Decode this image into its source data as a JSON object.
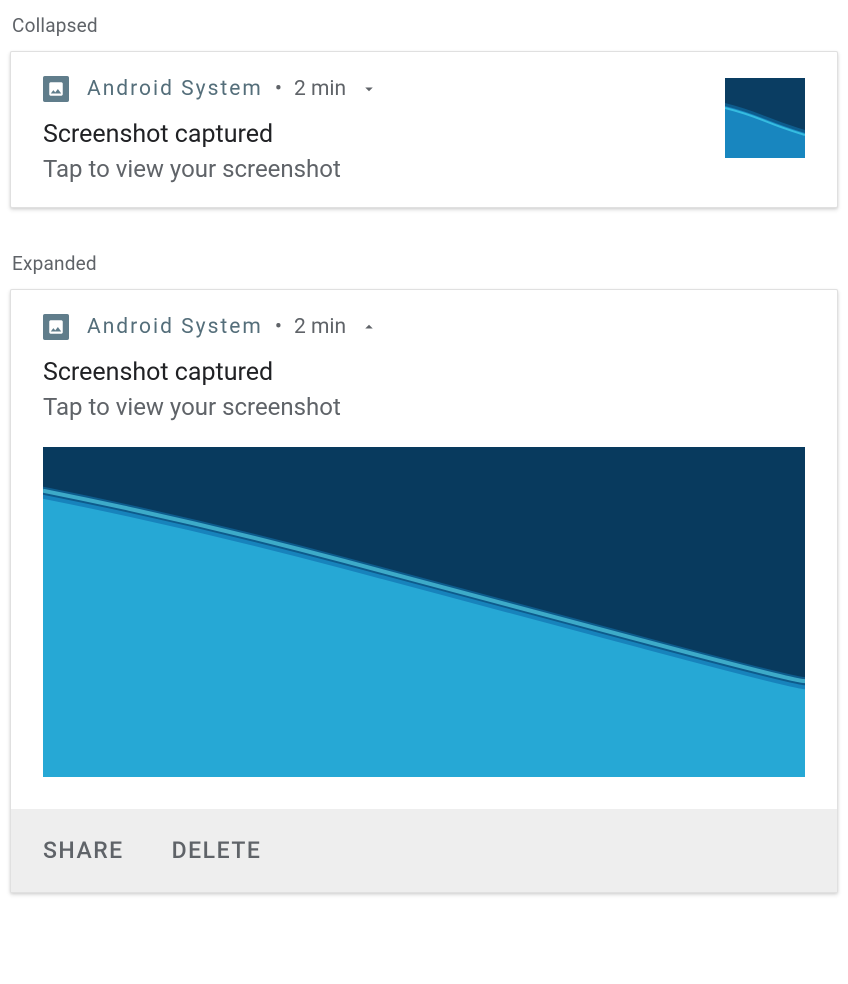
{
  "labels": {
    "collapsed": "Collapsed",
    "expanded": "Expanded"
  },
  "notification": {
    "app_name": "Android System",
    "separator": "•",
    "timestamp": "2 min",
    "title": "Screenshot captured",
    "subtitle": "Tap to view your screenshot"
  },
  "actions": {
    "share": "SHARE",
    "delete": "DELETE"
  },
  "colors": {
    "accent": "#607d8b",
    "app_name_color": "#546e7a",
    "text_primary": "#202124",
    "text_secondary": "#5f6368"
  }
}
